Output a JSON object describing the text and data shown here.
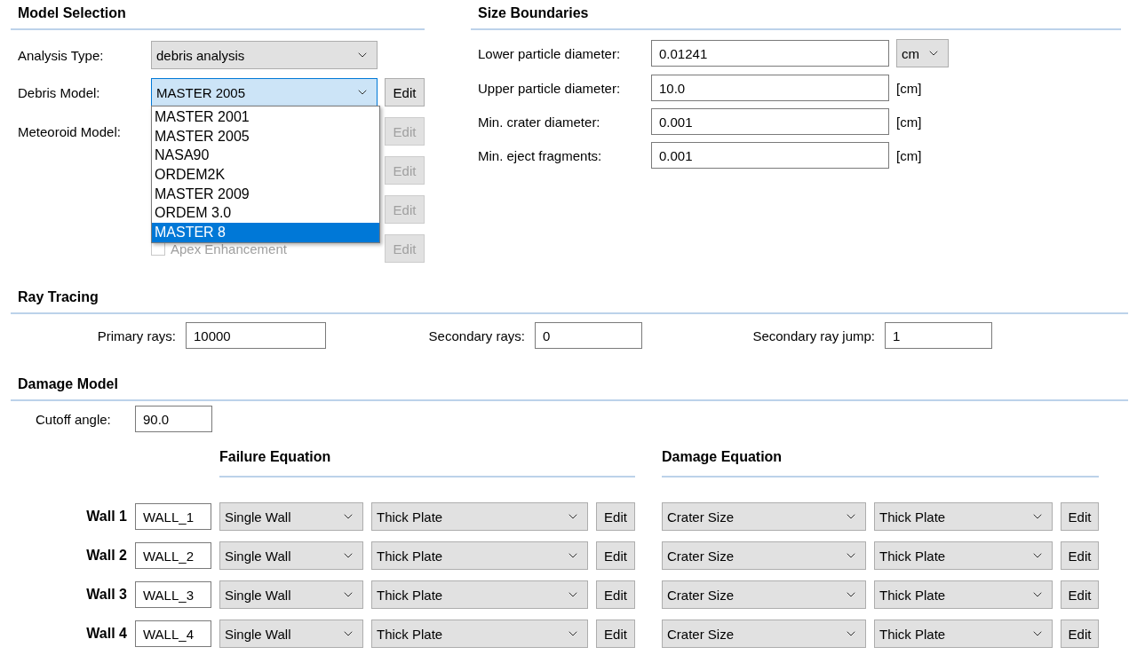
{
  "model_selection": {
    "title": "Model Selection",
    "rows": [
      {
        "kind": "combo",
        "label": "Analysis Type:",
        "value": "debris analysis",
        "focused": false
      },
      {
        "kind": "combo",
        "label": "Debris Model:",
        "value": "MASTER 2005",
        "focused": true,
        "edit": {
          "label": "Edit",
          "disabled": false
        },
        "options": [
          {
            "label": "MASTER 2001",
            "highlighted": false
          },
          {
            "label": "MASTER 2005",
            "highlighted": false
          },
          {
            "label": "NASA90",
            "highlighted": false
          },
          {
            "label": "ORDEM2K",
            "highlighted": false
          },
          {
            "label": "MASTER 2009",
            "highlighted": false
          },
          {
            "label": "ORDEM 3.0",
            "highlighted": false
          },
          {
            "label": "MASTER 8",
            "highlighted": true
          }
        ]
      },
      {
        "kind": "label",
        "label": "Meteoroid Model:",
        "edit": {
          "label": "Edit",
          "disabled": true
        }
      },
      {
        "kind": "empty",
        "edit": {
          "label": "Edit",
          "disabled": true
        }
      },
      {
        "kind": "empty",
        "edit": {
          "label": "Edit",
          "disabled": true
        }
      },
      {
        "kind": "checkbox",
        "label": "Apex Enhancement",
        "checked": false,
        "edit": {
          "label": "Edit",
          "disabled": true
        }
      }
    ]
  },
  "size_boundaries": {
    "title": "Size Boundaries",
    "rows": [
      {
        "label": "Lower particle diameter:",
        "value": "0.01241",
        "unit": {
          "kind": "select",
          "text": "cm"
        }
      },
      {
        "label": "Upper particle diameter:",
        "value": "10.0",
        "unit": {
          "kind": "text",
          "text": "[cm]"
        }
      },
      {
        "label": "Min. crater diameter:",
        "value": "0.001",
        "unit": {
          "kind": "text",
          "text": "[cm]"
        }
      },
      {
        "label": "Min. eject fragments:",
        "value": "0.001",
        "unit": {
          "kind": "text",
          "text": "[cm]"
        }
      }
    ]
  },
  "ray_tracing": {
    "title": "Ray Tracing",
    "fields": [
      {
        "label": "Primary rays:",
        "value": "10000"
      },
      {
        "label": "Secondary rays:",
        "value": "0"
      },
      {
        "label": "Secondary ray jump:",
        "value": "1"
      }
    ]
  },
  "damage_model": {
    "title": "Damage Model",
    "cutoff": {
      "label": "Cutoff angle:",
      "value": "90.0"
    },
    "headings": [
      "Failure Equation",
      "Damage Equation"
    ],
    "walls": [
      {
        "label": "Wall 1",
        "name": "WALL_1",
        "failure": [
          "Single Wall",
          "Thick Plate"
        ],
        "failure_edit": "Edit",
        "damage": [
          "Crater Size",
          "Thick Plate"
        ],
        "damage_edit": "Edit"
      },
      {
        "label": "Wall 2",
        "name": "WALL_2",
        "failure": [
          "Single Wall",
          "Thick Plate"
        ],
        "failure_edit": "Edit",
        "damage": [
          "Crater Size",
          "Thick Plate"
        ],
        "damage_edit": "Edit"
      },
      {
        "label": "Wall 3",
        "name": "WALL_3",
        "failure": [
          "Single Wall",
          "Thick Plate"
        ],
        "failure_edit": "Edit",
        "damage": [
          "Crater Size",
          "Thick Plate"
        ],
        "damage_edit": "Edit"
      },
      {
        "label": "Wall 4",
        "name": "WALL_4",
        "failure": [
          "Single Wall",
          "Thick Plate"
        ],
        "failure_edit": "Edit",
        "damage": [
          "Crater Size",
          "Thick Plate"
        ],
        "damage_edit": "Edit"
      }
    ]
  }
}
